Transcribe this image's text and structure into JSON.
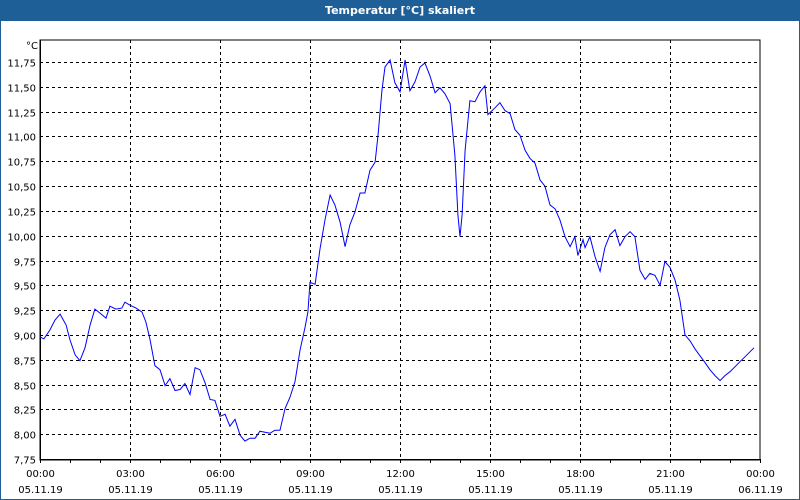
{
  "window": {
    "title": "Temperatur [°C] skaliert"
  },
  "chart_data": {
    "type": "line",
    "title": "Temperatur [°C] skaliert",
    "ylabel": "°C",
    "xlabel": "",
    "ylim": [
      7.75,
      11.97
    ],
    "xlim_hours": [
      0,
      24
    ],
    "grid": true,
    "y_ticks": [
      "11,75",
      "11,50",
      "11,25",
      "11,00",
      "10,75",
      "10,50",
      "10,25",
      "10,00",
      "9,75",
      "9,50",
      "9,25",
      "9,00",
      "8,75",
      "8,50",
      "8,25",
      "8,00",
      "7,75"
    ],
    "y_tick_values": [
      11.75,
      11.5,
      11.25,
      11.0,
      10.75,
      10.5,
      10.25,
      10.0,
      9.75,
      9.5,
      9.25,
      9.0,
      8.75,
      8.5,
      8.25,
      8.0,
      7.75
    ],
    "x_ticks": [
      {
        "hour": 0,
        "time": "00:00",
        "date": "05.11.19"
      },
      {
        "hour": 3,
        "time": "03:00",
        "date": "05.11.19"
      },
      {
        "hour": 6,
        "time": "06:00",
        "date": "05.11.19"
      },
      {
        "hour": 9,
        "time": "09:00",
        "date": "05.11.19"
      },
      {
        "hour": 12,
        "time": "12:00",
        "date": "05.11.19"
      },
      {
        "hour": 15,
        "time": "15:00",
        "date": "05.11.19"
      },
      {
        "hour": 18,
        "time": "18:00",
        "date": "05.11.19"
      },
      {
        "hour": 21,
        "time": "21:00",
        "date": "05.11.19"
      },
      {
        "hour": 24,
        "time": "00:00",
        "date": "06.11.19"
      }
    ],
    "series": [
      {
        "name": "Temperatur",
        "color": "#0000ff",
        "x_hours": [
          0,
          0.13,
          0.33,
          0.5,
          0.67,
          0.87,
          1,
          1.17,
          1.33,
          1.5,
          1.67,
          1.83,
          2,
          2.2,
          2.33,
          2.53,
          2.73,
          2.83,
          3,
          3.2,
          3.4,
          3.53,
          3.67,
          3.83,
          4,
          4.17,
          4.33,
          4.5,
          4.67,
          4.83,
          5,
          5.17,
          5.33,
          5.5,
          5.67,
          5.83,
          6,
          6.17,
          6.33,
          6.5,
          6.67,
          6.83,
          7,
          7.17,
          7.33,
          7.5,
          7.67,
          7.83,
          8,
          8.17,
          8.33,
          8.5,
          8.67,
          8.83,
          8.93,
          9,
          9.17,
          9.33,
          9.5,
          9.67,
          9.83,
          10,
          10.17,
          10.33,
          10.5,
          10.67,
          10.83,
          11,
          11.17,
          11.27,
          11.4,
          11.5,
          11.67,
          11.83,
          12,
          12.17,
          12.33,
          12.5,
          12.67,
          12.83,
          13,
          13.17,
          13.33,
          13.5,
          13.67,
          13.83,
          13.93,
          14,
          14.07,
          14.17,
          14.33,
          14.5,
          14.67,
          14.83,
          14.93,
          15,
          15.17,
          15.33,
          15.5,
          15.67,
          15.83,
          16,
          16.17,
          16.33,
          16.5,
          16.67,
          16.83,
          17,
          17.17,
          17.33,
          17.5,
          17.67,
          17.83,
          17.93,
          18.1,
          18.17,
          18.33,
          18.5,
          18.67,
          18.83,
          19,
          19.17,
          19.33,
          19.5,
          19.67,
          19.83,
          20,
          20.17,
          20.33,
          20.5,
          20.67,
          20.83,
          21,
          21.17,
          21.33,
          21.5,
          21.67,
          21.83,
          22,
          22.17,
          22.33,
          22.5,
          22.67,
          22.83,
          23,
          23.17,
          23.33,
          23.5,
          23.8
        ],
        "values": [
          8.98,
          8.96,
          9.05,
          9.15,
          9.21,
          9.1,
          8.95,
          8.8,
          8.74,
          8.87,
          9.1,
          9.26,
          9.22,
          9.17,
          9.29,
          9.26,
          9.27,
          9.33,
          9.3,
          9.27,
          9.23,
          9.13,
          8.95,
          8.69,
          8.65,
          8.49,
          8.56,
          8.44,
          8.45,
          8.51,
          8.4,
          8.67,
          8.65,
          8.52,
          8.35,
          8.34,
          8.18,
          8.2,
          8.08,
          8.15,
          7.99,
          7.93,
          7.96,
          7.96,
          8.03,
          8.02,
          8.01,
          8.04,
          8.04,
          8.26,
          8.37,
          8.53,
          8.85,
          9.07,
          9.23,
          9.53,
          9.51,
          9.86,
          10.16,
          10.41,
          10.31,
          10.14,
          9.89,
          10.11,
          10.24,
          10.43,
          10.43,
          10.66,
          10.74,
          11.02,
          11.47,
          11.7,
          11.77,
          11.54,
          11.45,
          11.77,
          11.46,
          11.55,
          11.7,
          11.74,
          11.61,
          11.44,
          11.49,
          11.43,
          11.33,
          10.81,
          10.21,
          9.99,
          10.21,
          10.86,
          11.36,
          11.35,
          11.45,
          11.51,
          11.22,
          11.24,
          11.29,
          11.34,
          11.26,
          11.23,
          11.07,
          11.01,
          10.86,
          10.78,
          10.73,
          10.56,
          10.5,
          10.31,
          10.27,
          10.16,
          9.99,
          9.89,
          9.99,
          9.8,
          9.96,
          9.88,
          9.99,
          9.79,
          9.64,
          9.88,
          10.01,
          10.06,
          9.9,
          9.99,
          10.04,
          9.99,
          9.65,
          9.56,
          9.62,
          9.6,
          9.5,
          9.74,
          9.68,
          9.55,
          9.35,
          9.0,
          8.94,
          8.86,
          8.79,
          8.72,
          8.65,
          8.59,
          8.54,
          8.59,
          8.63,
          8.68,
          8.73,
          8.78,
          8.87
        ]
      }
    ]
  }
}
